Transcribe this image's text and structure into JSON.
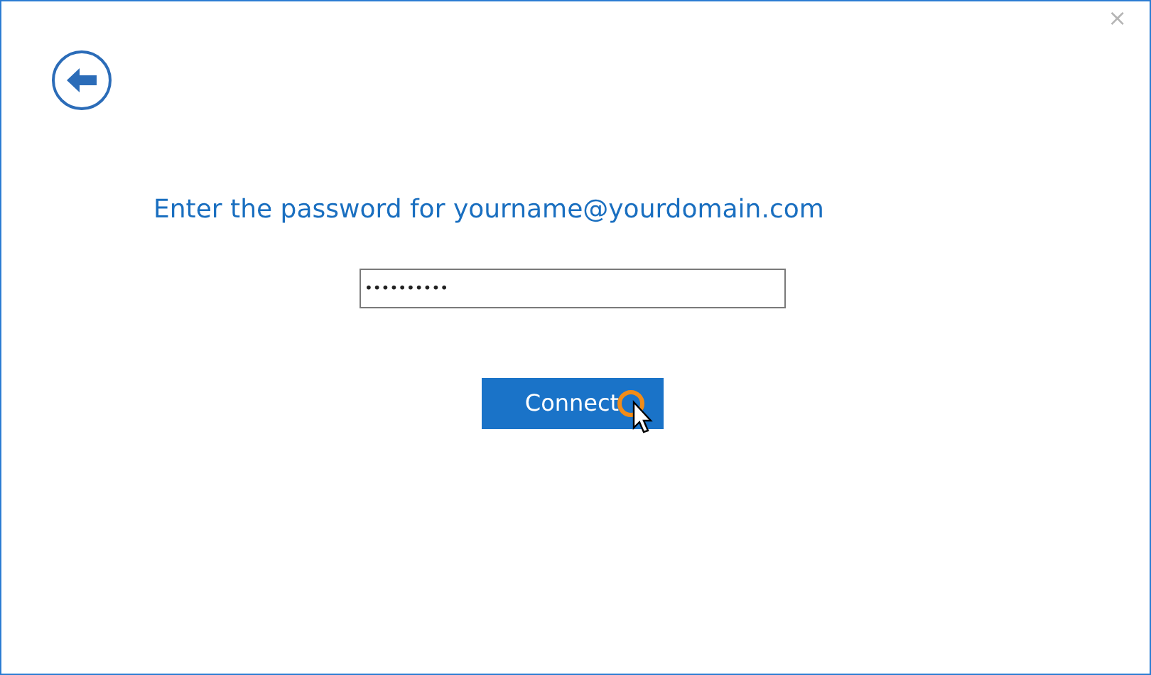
{
  "window": {
    "close": "×"
  },
  "heading": "Enter the password for yourname@yourdomain.com",
  "password_field": {
    "value": "••••••••••"
  },
  "connect_button": {
    "label": "Connect"
  }
}
